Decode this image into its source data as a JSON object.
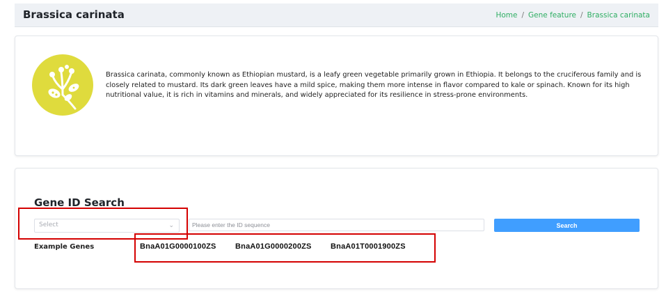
{
  "header": {
    "title": "Brassica carinata",
    "breadcrumb": [
      "Home",
      "Gene feature",
      "Brassica carinata"
    ],
    "separator": "/"
  },
  "intro": {
    "logo_icon": "flower-plant-icon",
    "logo_color": "#dfdb3d",
    "description": "Brassica carinata, commonly known as Ethiopian mustard, is a leafy green vegetable primarily grown in Ethiopia. It belongs to the cruciferous family and is closely related to mustard. Its dark green leaves have a mild spice, making them more intense in flavor compared to kale or spinach. Known for its high nutritional value, it is rich in vitamins and minerals, and widely appreciated for its resilience in stress-prone environments."
  },
  "search": {
    "title": "Gene ID Search",
    "select_placeholder": "Select",
    "input_placeholder": "Please enter the ID sequence",
    "button_label": "Search",
    "button_color": "#409eff",
    "example_label": "Example Genes",
    "example_genes": [
      "BnaA01G0000100ZS",
      "BnaA01G0000200ZS",
      "BnaA01T0001900ZS"
    ]
  },
  "colors": {
    "breadcrumb": "#2fae63",
    "highlight": "#d40000"
  }
}
